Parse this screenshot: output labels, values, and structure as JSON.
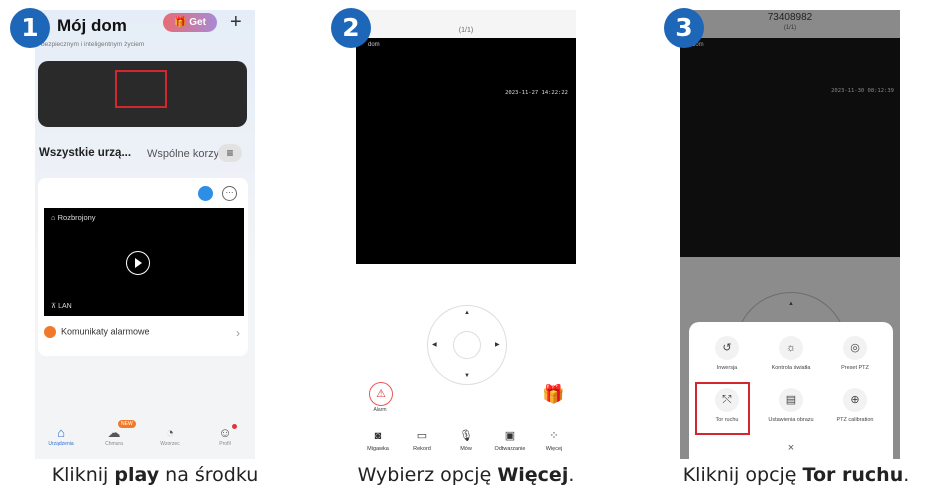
{
  "badges": [
    "1",
    "2",
    "3"
  ],
  "captions": [
    {
      "pre": "Kliknij ",
      "bold": "play",
      "post": " na środku"
    },
    {
      "pre": "Wybierz opcję ",
      "bold": "Więcej",
      "post": "."
    },
    {
      "pre": "Kliknij opcję ",
      "bold": "Tor ruchu",
      "post": "."
    }
  ],
  "screen1": {
    "title": "Mój dom",
    "subtitle": "bezpiecznym i inteligentnym życiem",
    "get_label": "Get",
    "add_icon": "plus-icon",
    "tabs": [
      "Wszystkie urzą...",
      "Wspólne korzy"
    ],
    "menu_icon": "menu-icon",
    "device": {
      "status": "Rozbrojony",
      "connection": "LAN"
    },
    "alarm_messages": "Komunikaty alarmowe",
    "nav": [
      {
        "label": "Urządzenia",
        "icon": "home-icon",
        "active": true
      },
      {
        "label": "Chmura",
        "icon": "cloud-icon",
        "tag": "NEW"
      },
      {
        "label": "Wzorzec",
        "icon": "compass-icon"
      },
      {
        "label": "Profil",
        "icon": "profile-icon",
        "dot": true
      }
    ],
    "colors": {
      "accent": "#2e6fd8",
      "highlight": "#d4262d"
    }
  },
  "screen2": {
    "counter": "(1/1)",
    "video_title": "dom",
    "timestamp": "2023-11-27 14:22:22",
    "alarm_label": "Alarm",
    "toolbar": [
      {
        "label": "Migawka",
        "icon": "camera-icon"
      },
      {
        "label": "Rekord",
        "icon": "record-icon"
      },
      {
        "label": "Mów",
        "icon": "microphone-icon"
      },
      {
        "label": "Odtwarzanie",
        "icon": "playback-icon"
      },
      {
        "label": "Więcej",
        "icon": "more-icon"
      }
    ]
  },
  "screen3": {
    "device_id": "73408982",
    "counter": "(1/1)",
    "video_title": "dom",
    "timestamp": "2023-11-30 08:12:39",
    "options": [
      {
        "label": "Inwersja",
        "icon": "rotate-icon"
      },
      {
        "label": "Kontrola światła",
        "icon": "light-icon"
      },
      {
        "label": "Preset PTZ",
        "icon": "preset-icon"
      },
      {
        "label": "Tor ruchu",
        "icon": "track-icon"
      },
      {
        "label": "Ustawienia obrazu",
        "icon": "image-settings-icon"
      },
      {
        "label": "PTZ calibration",
        "icon": "calibration-icon"
      }
    ],
    "close_label": "×"
  }
}
